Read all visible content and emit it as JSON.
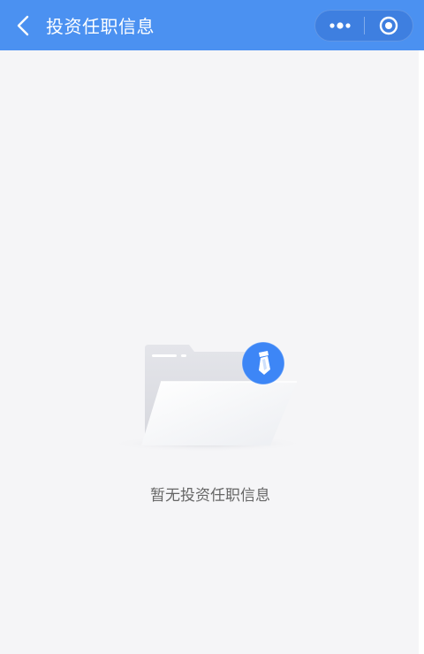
{
  "header": {
    "title": "投资任职信息",
    "back_icon": "chevron-left-icon",
    "more_icon": "more-dots-icon",
    "close_icon": "target-close-icon",
    "bg_color": "#4b91f1"
  },
  "empty_state": {
    "message": "暂无投资任职信息",
    "illustration_icon": "empty-folder-tie-icon",
    "badge_color": "#3d86f6"
  }
}
